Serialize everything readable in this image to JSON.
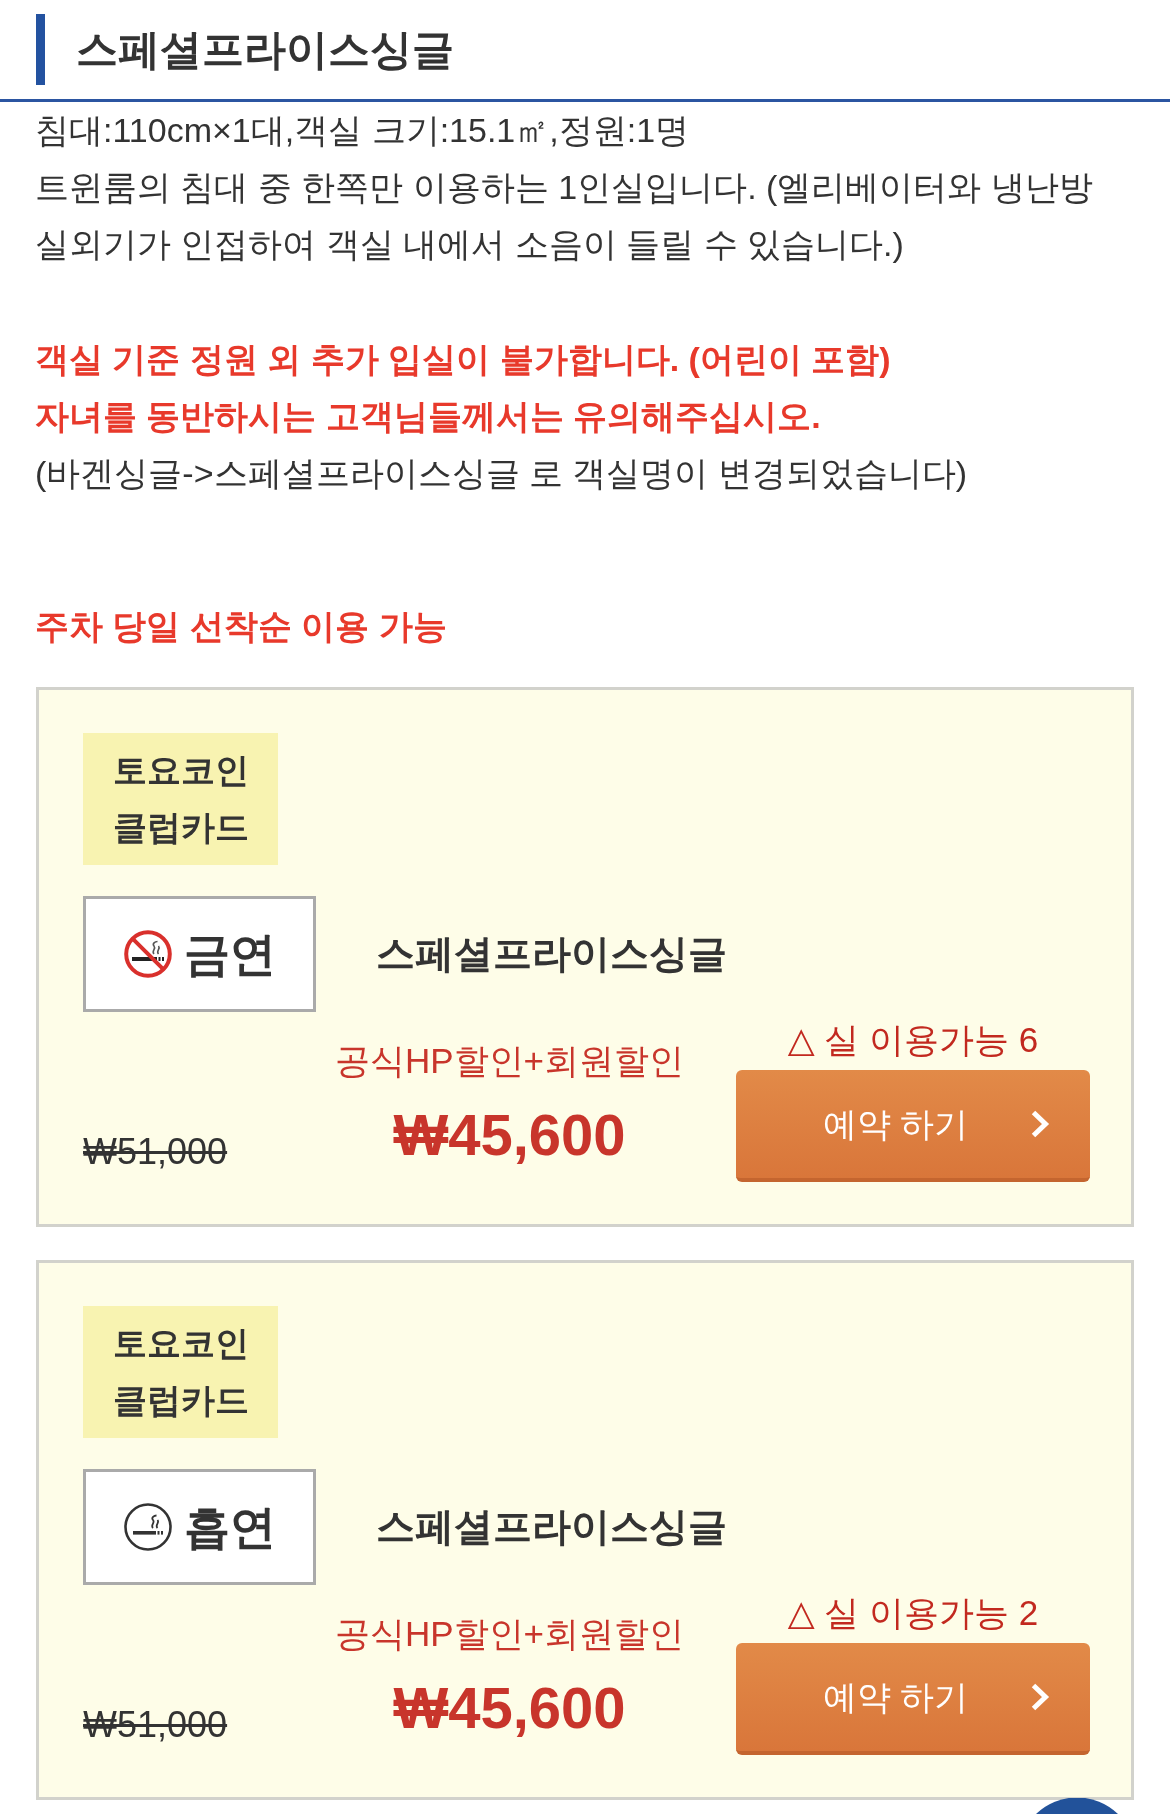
{
  "header": {
    "title": "스페셜프라이스싱글"
  },
  "room_info": [
    "침대:110cm×1대,객실 크기:15.1㎡,정원:1명",
    "트윈룸의 침대 중 한쪽만 이용하는 1인실입니다. (엘리베이터와 냉난방 실외기가 인접하여 객실 내에서 소음이 들릴 수 있습니다.)"
  ],
  "notices": [
    {
      "kind": "warning",
      "text": "객실 기준 정원 외 추가 입실이 불가합니다. (어린이 포함)"
    },
    {
      "kind": "warning",
      "text": "자녀를 동반하시는 고객님들께서는 유의해주십시오."
    },
    {
      "kind": "info",
      "text": "(바겐싱글->스페셜프라이스싱글 로 객실명이 변경되었습니다)"
    }
  ],
  "parking_notice": "주차 당일 선착순 이용 가능",
  "plans": [
    {
      "member_label": "토요코인 클럽카드",
      "smoking": {
        "kind": "non_smoking",
        "label": "금연"
      },
      "room_name": "스페셜프라이스싱글",
      "discount_label": "공식HP할인+회원할인",
      "regular_price": "₩51,000",
      "price": "₩45,600",
      "availability": "△ 실 이용가능 6",
      "button": "예약 하기"
    },
    {
      "member_label": "토요코인 클럽카드",
      "smoking": {
        "kind": "smoking",
        "label": "흡연"
      },
      "room_name": "스페셜프라이스싱글",
      "discount_label": "공식HP할인+회원할인",
      "regular_price": "₩51,000",
      "price": "₩45,600",
      "availability": "△ 실 이용가능 2",
      "button": "예약 하기"
    }
  ]
}
